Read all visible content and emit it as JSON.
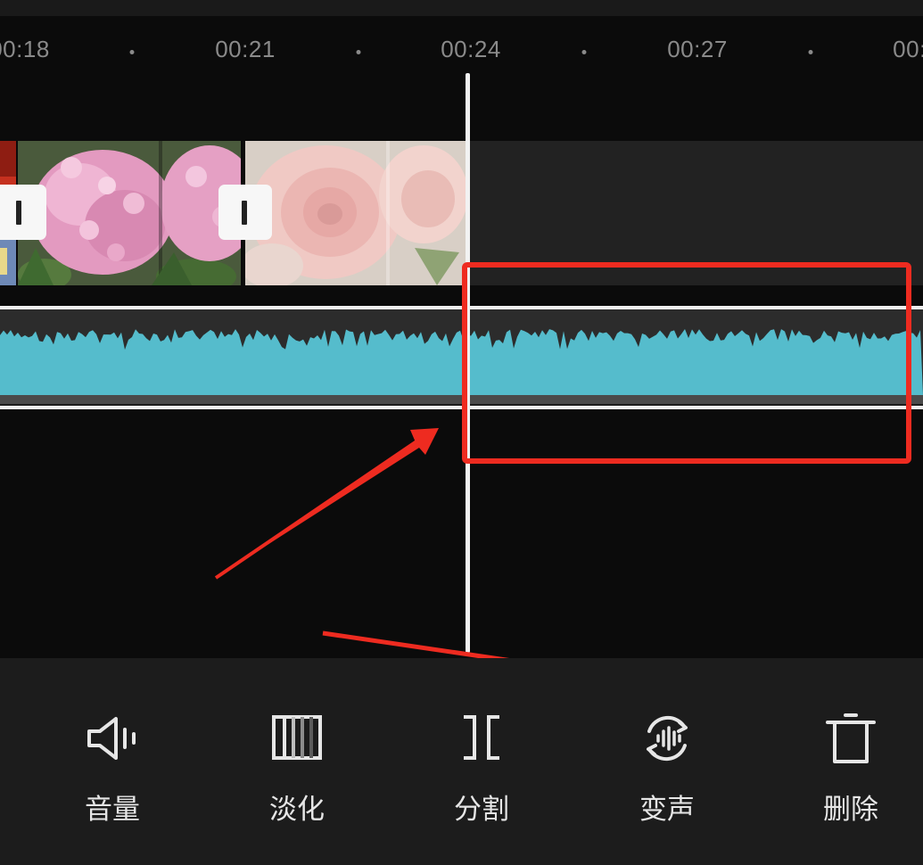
{
  "timeline": {
    "ticks": [
      {
        "label": "00:18"
      },
      {
        "label": "00:21"
      },
      {
        "label": "00:24"
      },
      {
        "label": "00:27"
      },
      {
        "label": "00:"
      }
    ]
  },
  "toolbar": {
    "items": [
      {
        "label": "音量",
        "icon": "volume-icon"
      },
      {
        "label": "淡化",
        "icon": "fade-icon"
      },
      {
        "label": "分割",
        "icon": "split-icon"
      },
      {
        "label": "变声",
        "icon": "voice-change-icon"
      },
      {
        "label": "删除",
        "icon": "delete-icon"
      }
    ]
  },
  "colors": {
    "background": "#0b0b0b",
    "toolbar_bg": "#1c1c1c",
    "waveform": "#55bccc",
    "annotation": "#ee2b20",
    "playhead": "#f2f2f2"
  }
}
